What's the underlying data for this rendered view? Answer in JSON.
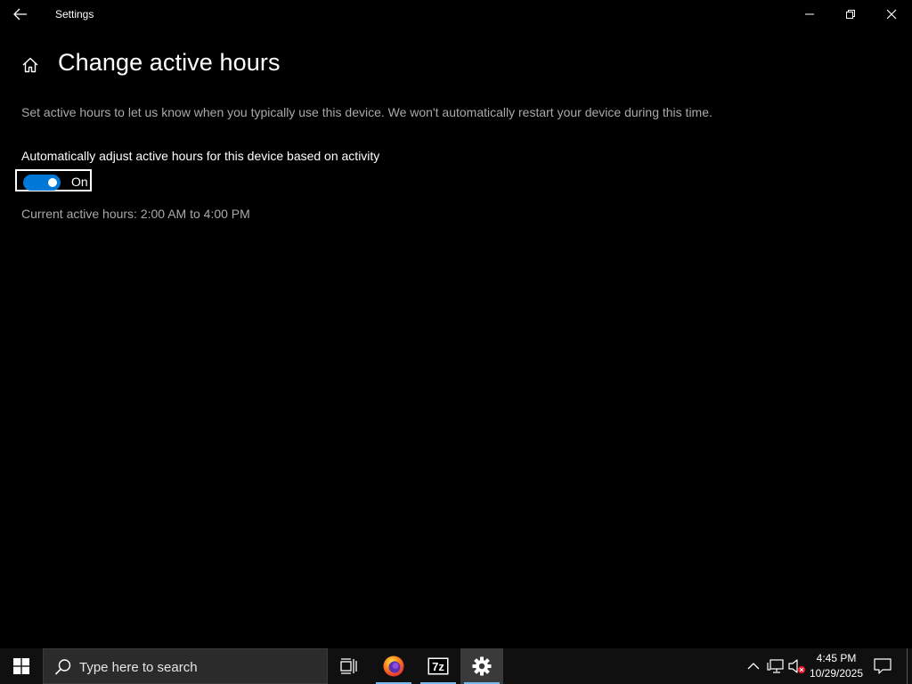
{
  "window": {
    "title": "Settings",
    "back_icon": "back-arrow-icon",
    "minimize_icon": "minimize-icon",
    "restore_icon": "restore-icon",
    "close_icon": "close-icon"
  },
  "page": {
    "home_icon": "home-icon",
    "title": "Change active hours",
    "description": "Set active hours to let us know when you typically use this device. We won't automatically restart your device during this time.",
    "toggle_label": "Automatically adjust active hours for this device based on activity",
    "toggle_state": "On",
    "toggle_on": true,
    "current_hours": "Current active hours: 2:00 AM to 4:00 PM"
  },
  "taskbar": {
    "search_placeholder": "Type here to search",
    "apps": [
      {
        "name": "Task View",
        "icon": "task-view-icon",
        "active": false
      },
      {
        "name": "Firefox",
        "icon": "firefox-icon",
        "active": false
      },
      {
        "name": "7-Zip",
        "icon": "7zip-icon",
        "active": false
      },
      {
        "name": "Settings",
        "icon": "settings-gear-icon",
        "active": true
      }
    ],
    "time": "4:45 PM",
    "date": "10/29/2025"
  },
  "colors": {
    "background": "#000000",
    "accent": "#0078d7",
    "secondary_text": "#a9a9a9",
    "taskbar": "#101010"
  }
}
